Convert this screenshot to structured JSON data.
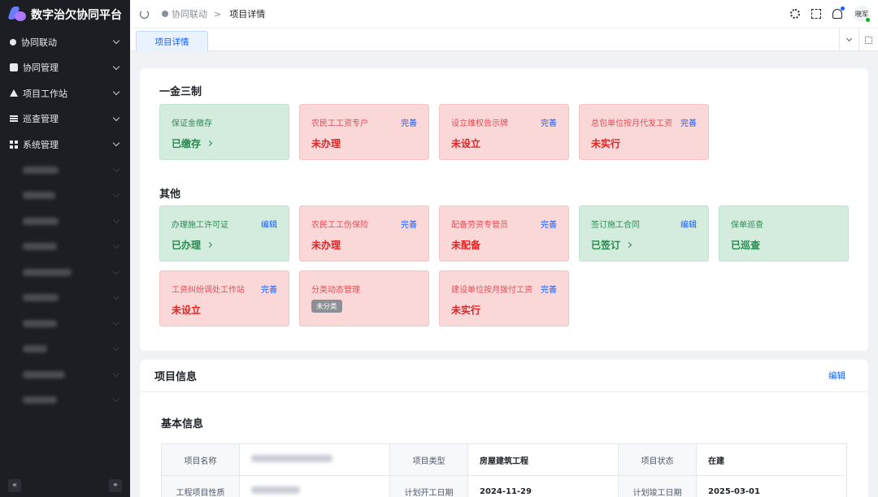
{
  "app": {
    "title": "数字治欠协同平台"
  },
  "sidebar": {
    "items": [
      {
        "label": "协同联动",
        "icon": "link-icon"
      },
      {
        "label": "协同管理",
        "icon": "folder-icon"
      },
      {
        "label": "项目工作站",
        "icon": "home-icon"
      },
      {
        "label": "巡查管理",
        "icon": "list-icon"
      },
      {
        "label": "系统管理",
        "icon": "grid-icon"
      }
    ],
    "collapse_symbol": "«",
    "pin_symbol": "⌖"
  },
  "header": {
    "breadcrumb_parent": "协同联动",
    "breadcrumb_sep": ">",
    "breadcrumb_current": "项目详情",
    "user_name": "晓军"
  },
  "tabs": {
    "active_label": "项目详情"
  },
  "section1": {
    "title": "一金三制",
    "tiles": [
      {
        "name": "保证金缴存",
        "action": "",
        "status": "已缴存",
        "tone": "green",
        "arrow": true
      },
      {
        "name": "农民工工资专户",
        "action": "完善",
        "status": "未办理",
        "tone": "red"
      },
      {
        "name": "设立维权告示牌",
        "action": "完善",
        "status": "未设立",
        "tone": "red"
      },
      {
        "name": "总包单位按月代发工资",
        "action": "完善",
        "status": "未实行",
        "tone": "red"
      }
    ]
  },
  "section2": {
    "title": "其他",
    "tiles": [
      {
        "name": "办理施工许可证",
        "action": "编辑",
        "status": "已办理",
        "tone": "green",
        "arrow": true
      },
      {
        "name": "农民工工伤保险",
        "action": "完善",
        "status": "未办理",
        "tone": "red"
      },
      {
        "name": "配备劳资专管员",
        "action": "完善",
        "status": "未配备",
        "tone": "red"
      },
      {
        "name": "签订施工合同",
        "action": "编辑",
        "status": "已签订",
        "tone": "green",
        "arrow": true
      },
      {
        "name": "保单巡查",
        "action": "",
        "status": "已巡查",
        "tone": "green"
      },
      {
        "name": "工资纠纷调处工作站",
        "action": "完善",
        "status": "未设立",
        "tone": "red"
      },
      {
        "name": "分类动态管理",
        "action": "",
        "status": "",
        "badge": "未分类",
        "tone": "red"
      },
      {
        "name": "建设单位按月拨付工资",
        "action": "完善",
        "status": "未实行",
        "tone": "red"
      }
    ]
  },
  "project_info": {
    "title": "项目信息",
    "edit_label": "编辑",
    "basic_title": "基本信息",
    "rows": [
      [
        {
          "k": "项目名称",
          "v": ""
        },
        {
          "k": "项目类型",
          "v": "房屋建筑工程"
        },
        {
          "k": "项目状态",
          "v": "在建"
        }
      ],
      [
        {
          "k": "工程项目性质",
          "v": ""
        },
        {
          "k": "计划开工日期",
          "v": "2024-11-29"
        },
        {
          "k": "计划竣工日期",
          "v": "2025-03-01"
        }
      ]
    ]
  },
  "colors": {
    "primary": "#165dff",
    "sidebar_bg": "#1d1e23",
    "success_bg": "#d4ecde",
    "danger_bg": "#fad8d8"
  }
}
